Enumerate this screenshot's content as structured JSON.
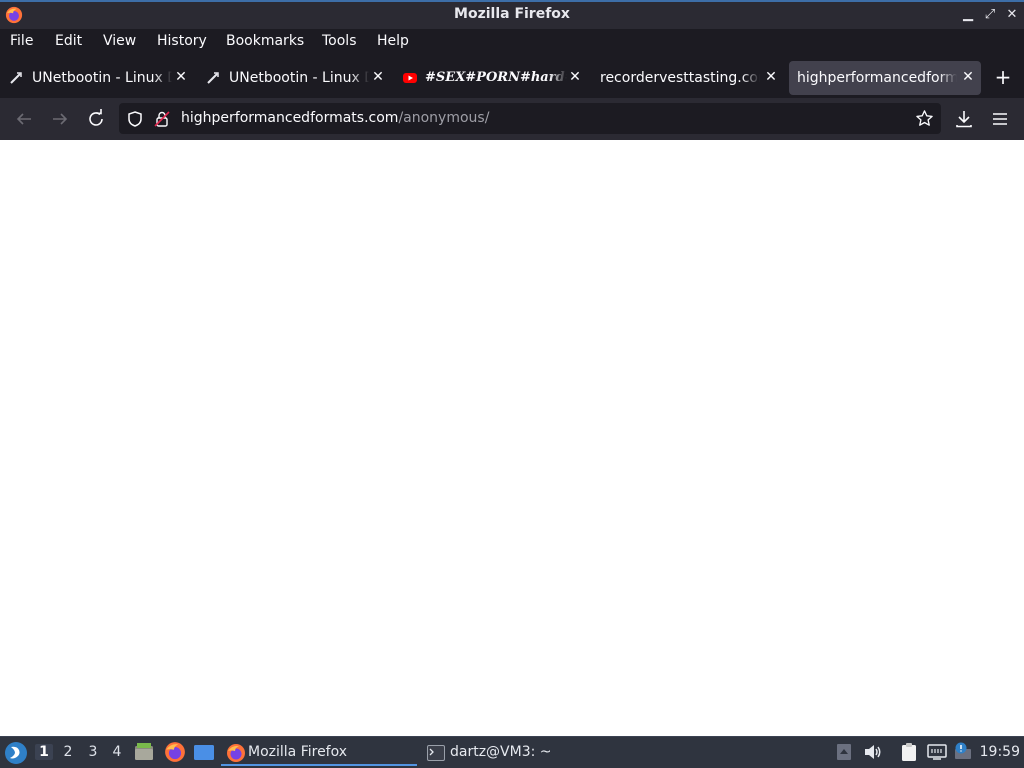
{
  "window": {
    "title": "Mozilla Firefox"
  },
  "menu": [
    "File",
    "Edit",
    "View",
    "History",
    "Bookmarks",
    "Tools",
    "Help"
  ],
  "tabs": [
    {
      "label": "UNetbootin - Linux D",
      "icon": "unetbootin-icon"
    },
    {
      "label": "UNetbootin - Linux D",
      "icon": "unetbootin-icon"
    },
    {
      "label": "#SEX#PORN#hard#h",
      "icon": "youtube-icon"
    },
    {
      "label": "recordervesttasting.com",
      "icon": ""
    },
    {
      "label": "highperformancedformats",
      "icon": "",
      "active": true
    }
  ],
  "url": {
    "host": "highperformancedformats.com",
    "path": "/anonymous/"
  },
  "taskbar": {
    "workspaces": [
      "1",
      "2",
      "3",
      "4"
    ],
    "tasks": [
      {
        "label": "Mozilla Firefox",
        "icon": "firefox-icon",
        "active": true
      },
      {
        "label": "dartz@VM3: ~",
        "icon": "terminal-icon",
        "active": false
      }
    ],
    "clock": "19:59"
  },
  "colors": {
    "accent": "#5294e2",
    "chrome": "#2b2a33",
    "tab_active": "#42414d"
  }
}
